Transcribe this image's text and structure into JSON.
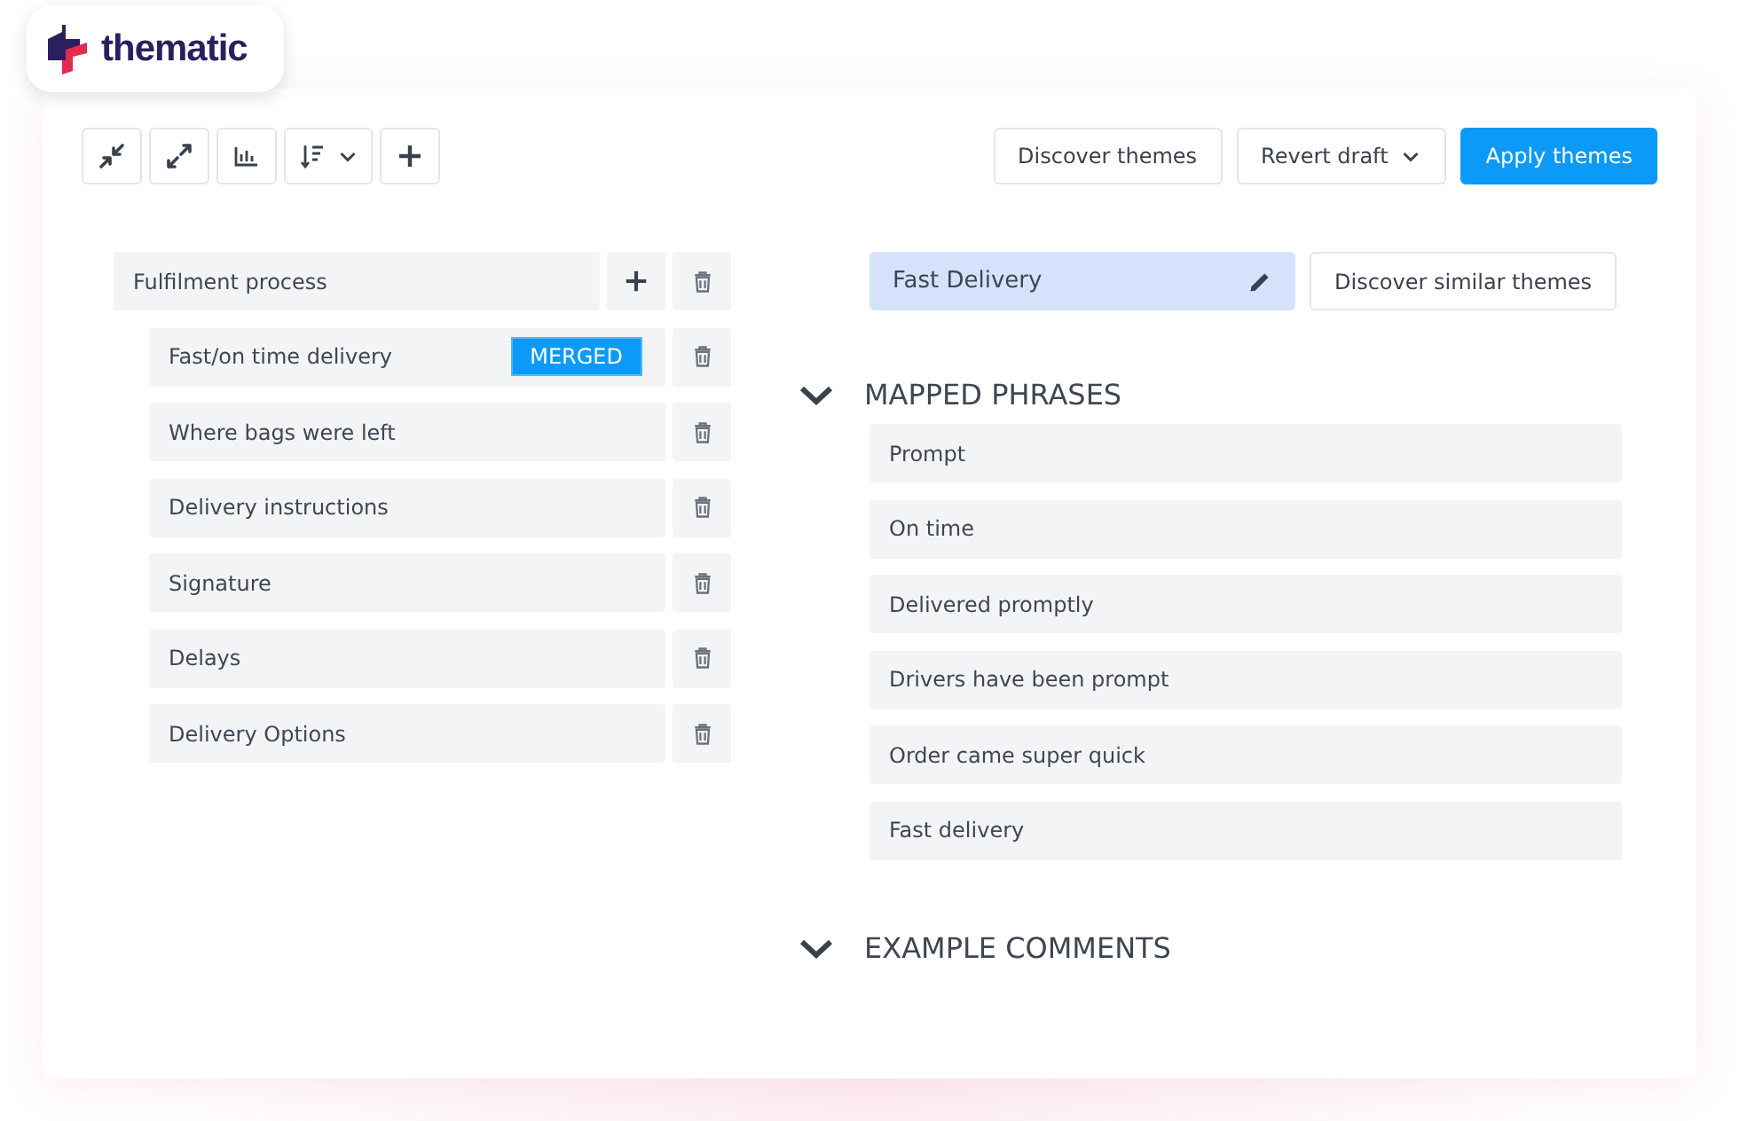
{
  "logo": {
    "text": "thematic"
  },
  "toolbar": {
    "tools": [
      {
        "kind": "collapse"
      },
      {
        "kind": "expand"
      },
      {
        "kind": "chart"
      },
      {
        "kind": "sort"
      },
      {
        "kind": "add"
      }
    ],
    "actions": [
      {
        "label": "Discover themes",
        "kind": "plain"
      },
      {
        "label": "Revert draft",
        "kind": "dropdown"
      },
      {
        "label": "Apply themes",
        "kind": "primary"
      }
    ]
  },
  "theme_tree": {
    "label": "Fulfilment process",
    "children": [
      {
        "label": "Fast/on time delivery",
        "tag": "MERGED"
      },
      {
        "label": "Where bags were left"
      },
      {
        "label": "Delivery instructions"
      },
      {
        "label": "Signature"
      },
      {
        "label": "Delays"
      },
      {
        "label": "Delivery Options"
      }
    ]
  },
  "theme_editor": {
    "name": "Fast Delivery",
    "selected": true,
    "similar_button": "Discover similar themes",
    "sections": [
      {
        "title": "MAPPED PHRASES",
        "phrases": [
          "Prompt",
          "On time",
          "Delivered promptly",
          "Drivers have been prompt",
          "Order came super quick",
          "Fast delivery"
        ]
      },
      {
        "title": "EXAMPLE COMMENTS"
      }
    ]
  }
}
